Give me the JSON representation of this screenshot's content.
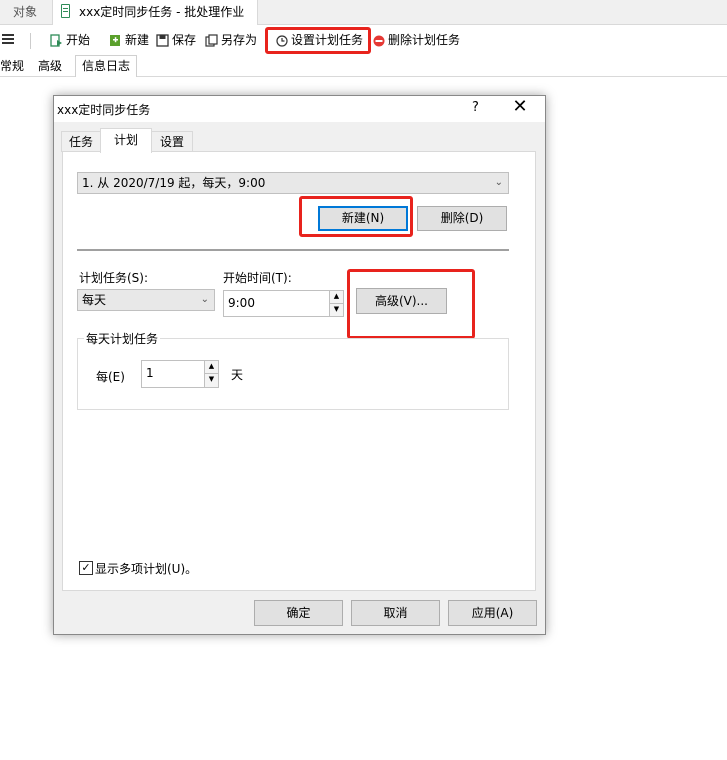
{
  "tabs": {
    "object": "对象",
    "document": "xxx定时同步任务 - 批处理作业"
  },
  "toolbar": {
    "start": "开始",
    "new": "新建",
    "save": "保存",
    "save_as": "另存为",
    "set_schedule": "设置计划任务",
    "delete_schedule": "删除计划任务"
  },
  "subtabs": {
    "general": "常规",
    "advanced": "高级",
    "log": "信息日志"
  },
  "dialog": {
    "title": "xxx定时同步任务",
    "help": "?",
    "close": "✕",
    "tabs": [
      "任务",
      "计划",
      "设置"
    ],
    "schedule_list_value": "1. 从 2020/7/19 起，每天，9:00",
    "new_button": "新建(N)",
    "delete_button": "删除(D)",
    "schedule_task_label": "计划任务(S):",
    "schedule_task_value": "每天",
    "start_time_label": "开始时间(T):",
    "start_time_value": "9:00",
    "advanced_button": "高级(V)...",
    "daily_group_legend": "每天计划任务",
    "every_label": "每(E)",
    "every_value": "1",
    "days_unit": "天",
    "show_multiple_label": "显示多项计划(U)。",
    "ok_button": "确定",
    "cancel_button": "取消",
    "apply_button": "应用(A)"
  },
  "colors": {
    "highlight": "#e8231d",
    "focus": "#0078d7"
  }
}
